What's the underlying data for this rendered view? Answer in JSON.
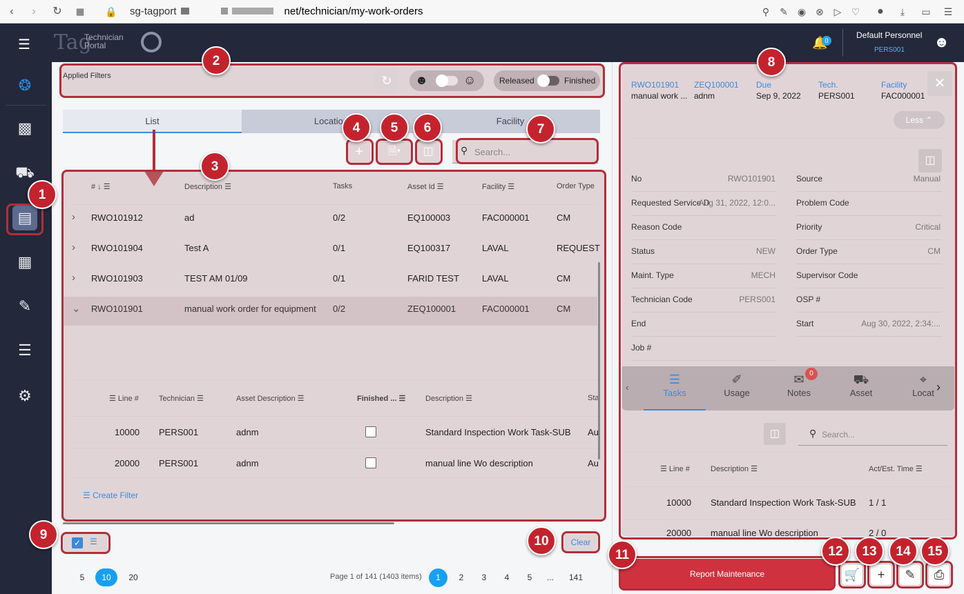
{
  "browser": {
    "url_prefix": "sg-tagport",
    "url_suffix": "net/technician/my-work-orders"
  },
  "app": {
    "logo_text": "Tag",
    "brand_line1": "Technician",
    "brand_line2": "Portal",
    "notif_count": "0",
    "user_name": "Default Personnel",
    "user_code": "PERS001"
  },
  "filters": {
    "label": "Applied Filters",
    "released": "Released",
    "finished": "Finished"
  },
  "tabs": [
    "List",
    "Location",
    "Facility"
  ],
  "search": {
    "placeholder": "Search..."
  },
  "table": {
    "headers": {
      "num": "#",
      "desc": "Description",
      "tasks": "Tasks",
      "asset": "Asset Id",
      "facility": "Facility",
      "otype": "Order Type"
    },
    "rows": [
      {
        "no": "RWO101912",
        "desc": "ad",
        "tasks": "0/2",
        "asset": "EQ100003",
        "facility": "FAC000001",
        "otype": "CM"
      },
      {
        "no": "RWO101904",
        "desc": "Test A",
        "tasks": "0/1",
        "asset": "EQ100317",
        "facility": "LAVAL",
        "otype": "REQUEST"
      },
      {
        "no": "RWO101903",
        "desc": "TEST AM 01/09",
        "tasks": "0/1",
        "asset": "FARID TEST",
        "facility": "LAVAL",
        "otype": "CM"
      },
      {
        "no": "RWO101901",
        "desc": "manual work order for equipment",
        "tasks": "0/2",
        "asset": "ZEQ100001",
        "facility": "FAC000001",
        "otype": "CM"
      }
    ],
    "sub_headers": {
      "line": "Line #",
      "tech": "Technician",
      "adesc": "Asset Description",
      "finished": "Finished ...",
      "desc": "Description",
      "sta": "Sta"
    },
    "sub_rows": [
      {
        "line": "10000",
        "tech": "PERS001",
        "adesc": "adnm",
        "desc": "Standard Inspection Work Task-SUB",
        "sta": "Au"
      },
      {
        "line": "20000",
        "tech": "PERS001",
        "adesc": "adnm",
        "desc": "manual line Wo description",
        "sta": "Au"
      }
    ],
    "create_filter": "Create Filter"
  },
  "footer": {
    "clear": "Clear",
    "sizes": [
      "5",
      "10",
      "20"
    ],
    "page_info": "Page 1 of 141 (1403 items)",
    "pages": [
      "1",
      "2",
      "3",
      "4",
      "5",
      "...",
      "141"
    ]
  },
  "detail": {
    "summary": [
      {
        "label": "RWO101901",
        "value": "manual work ..."
      },
      {
        "label": "ZEQ100001",
        "value": "adnm"
      },
      {
        "label": "Due",
        "value": "Sep 9, 2022"
      },
      {
        "label": "Tech.",
        "value": "PERS001"
      },
      {
        "label": "Facility",
        "value": "FAC000001"
      }
    ],
    "less": "Less",
    "fields_left": [
      {
        "label": "No",
        "value": "RWO101901"
      },
      {
        "label": "Requested Service D",
        "value": "Aug 31, 2022, 12:0..."
      },
      {
        "label": "Reason Code",
        "value": ""
      },
      {
        "label": "Status",
        "value": "NEW"
      },
      {
        "label": "Maint. Type",
        "value": "MECH"
      },
      {
        "label": "Technician Code",
        "value": "PERS001"
      },
      {
        "label": "End",
        "value": ""
      },
      {
        "label": "Job #",
        "value": ""
      }
    ],
    "fields_right": [
      {
        "label": "Source",
        "value": "Manual"
      },
      {
        "label": "Problem Code",
        "value": ""
      },
      {
        "label": "Priority",
        "value": "Critical"
      },
      {
        "label": "Order Type",
        "value": "CM"
      },
      {
        "label": "Supervisor Code",
        "value": ""
      },
      {
        "label": "OSP #",
        "value": ""
      },
      {
        "label": "Start",
        "value": "Aug 30, 2022, 2:34:..."
      }
    ],
    "tabs": [
      "Tasks",
      "Usage",
      "Notes",
      "Asset",
      "Locat"
    ],
    "notes_count": "0",
    "search_placeholder": "Search...",
    "task_headers": {
      "line": "Line #",
      "desc": "Description",
      "time": "Act/Est. Time"
    },
    "task_rows": [
      {
        "line": "10000",
        "desc": "Standard Inspection Work Task-SUB",
        "time": "1 / 1"
      },
      {
        "line": "20000",
        "desc": "manual line Wo description",
        "time": "2 / 0"
      }
    ],
    "report": "Report Maintenance"
  },
  "badges": [
    "1",
    "2",
    "3",
    "4",
    "5",
    "6",
    "7",
    "8",
    "9",
    "10",
    "11",
    "12",
    "13",
    "14",
    "15"
  ]
}
